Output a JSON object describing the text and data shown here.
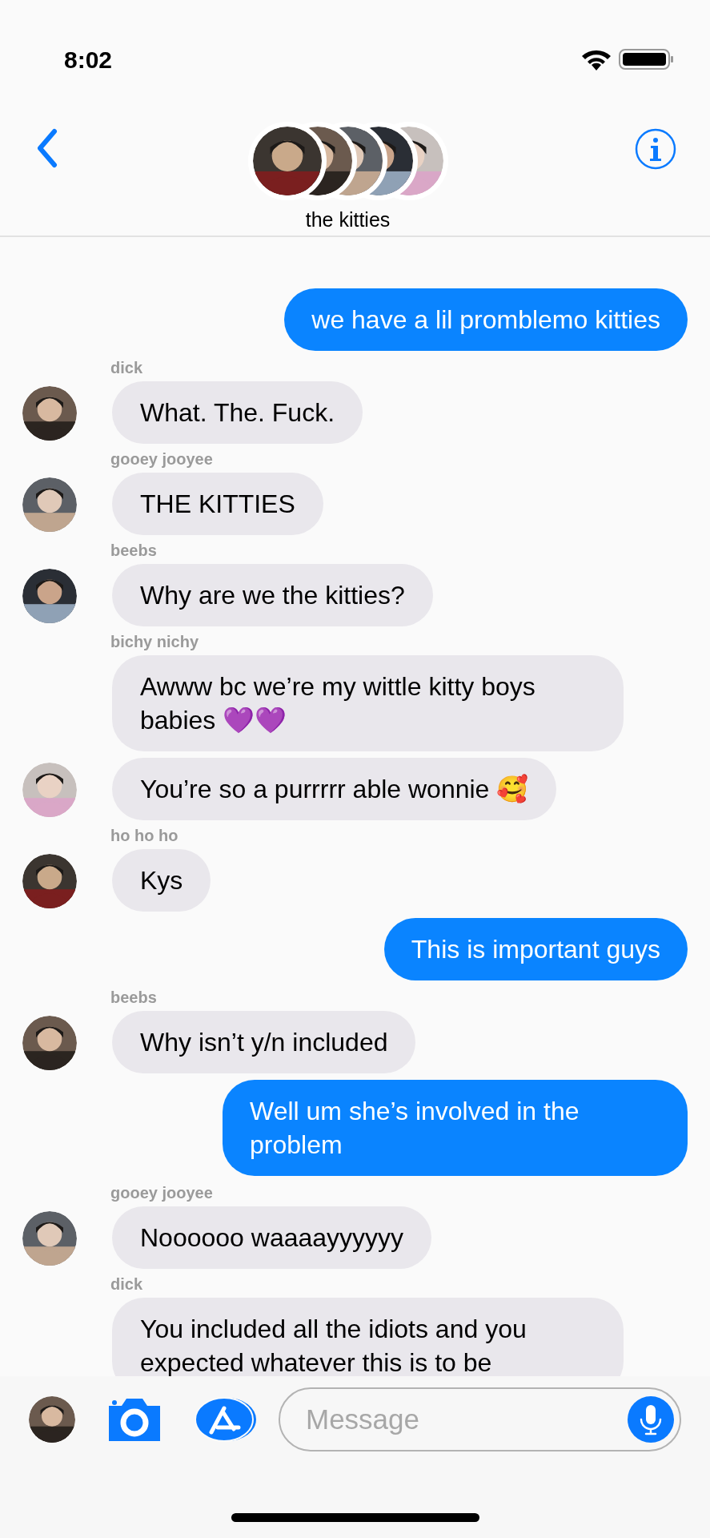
{
  "status_bar": {
    "time": "8:02"
  },
  "header": {
    "title": "the kitties"
  },
  "messages": [
    {
      "kind": "sent",
      "text": "we have a lil promblemo kitties"
    },
    {
      "kind": "received",
      "sender": "dick",
      "text": "What. The. Fuck.",
      "avatar": true
    },
    {
      "kind": "received",
      "sender": "gooey jooyee",
      "text": "THE KITTIES",
      "avatar": true
    },
    {
      "kind": "received",
      "sender": "beebs",
      "text": "Why are we the kitties?",
      "avatar": true
    },
    {
      "kind": "received",
      "sender": "bichy nichy",
      "text": "Awww bc we’re my wittle kitty boys babies 💜💜",
      "avatar": false
    },
    {
      "kind": "received",
      "text": "You’re so a purrrrr able wonnie 🥰",
      "avatar": true
    },
    {
      "kind": "received",
      "sender": "ho ho ho",
      "text": "Kys",
      "avatar": true
    },
    {
      "kind": "sent",
      "text": "This is important guys"
    },
    {
      "kind": "received",
      "sender": "beebs",
      "text": "Why isn’t y/n included",
      "avatar": true
    },
    {
      "kind": "sent",
      "text": "Well um she’s involved in the problem"
    },
    {
      "kind": "received",
      "sender": "gooey jooyee",
      "text": "Noooooo waaaayyyyyy",
      "avatar": true
    },
    {
      "kind": "received",
      "sender": "dick",
      "text": "You included all the idiots and you expected whatever this is to be",
      "avatar": false
    }
  ],
  "composer": {
    "placeholder": "Message"
  }
}
